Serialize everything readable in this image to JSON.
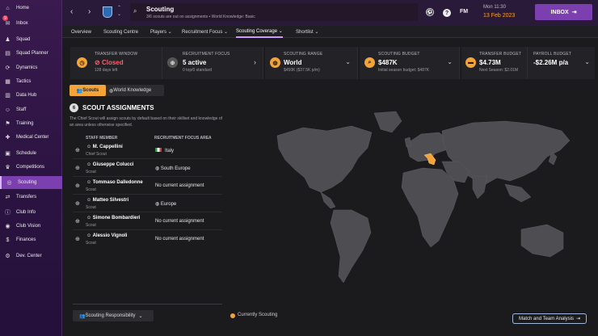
{
  "sidebar": {
    "items": [
      {
        "label": "Home",
        "icon": "home-icon"
      },
      {
        "label": "Inbox",
        "icon": "inbox-icon",
        "badge": "9"
      },
      {
        "label": "Squad",
        "icon": "squad-icon"
      },
      {
        "label": "Squad Planner",
        "icon": "planner-icon"
      },
      {
        "label": "Dynamics",
        "icon": "dynamics-icon"
      },
      {
        "label": "Tactics",
        "icon": "tactics-icon"
      },
      {
        "label": "Data Hub",
        "icon": "data-hub-icon"
      },
      {
        "label": "Staff",
        "icon": "staff-icon"
      },
      {
        "label": "Training",
        "icon": "training-icon"
      },
      {
        "label": "Medical Center",
        "icon": "medical-icon"
      },
      {
        "label": "Schedule",
        "icon": "schedule-icon"
      },
      {
        "label": "Competitions",
        "icon": "trophy-icon"
      },
      {
        "label": "Scouting",
        "icon": "scouting-icon",
        "active": true
      },
      {
        "label": "Transfers",
        "icon": "transfers-icon"
      },
      {
        "label": "Club Info",
        "icon": "info-icon"
      },
      {
        "label": "Club Vision",
        "icon": "vision-icon"
      },
      {
        "label": "Finances",
        "icon": "finances-icon"
      },
      {
        "label": "Dev. Center",
        "icon": "dev-center-icon"
      }
    ]
  },
  "header": {
    "title": "Scouting",
    "subtitle": "3/6 scouts are out on assignments • World Knowledge: Basic",
    "day": "Mon 11:30",
    "date": "13 Feb 2023",
    "inbox_label": "INBOX",
    "fm_logo": "FM",
    "help": "?"
  },
  "tabs": [
    {
      "label": "Overview"
    },
    {
      "label": "Scouting Centre"
    },
    {
      "label": "Players ⌄"
    },
    {
      "label": "Recruitment Focus ⌄"
    },
    {
      "label": "Scouting Coverage ⌄",
      "active": true
    },
    {
      "label": "Shortlist ⌄"
    }
  ],
  "cards": {
    "transfer_window": {
      "label": "TRANSFER WINDOW",
      "value": "Closed",
      "sub": "128 days left"
    },
    "recruitment_focus": {
      "label": "RECRUITMENT FOCUS",
      "value": "5 active",
      "sub": "0 top/0 standard"
    },
    "scouting_range": {
      "label": "SCOUTING RANGE",
      "value": "World",
      "sub": "$450K ($37.5K p/m)"
    },
    "scouting_budget": {
      "label": "SCOUTING BUDGET",
      "value": "$487K",
      "sub": "Initial season budget: $487K"
    },
    "transfer_budget": {
      "label": "TRANSFER BUDGET",
      "value": "$4.73M",
      "sub": "Next Season: $2.01M"
    },
    "payroll_budget": {
      "label": "PAYROLL BUDGET",
      "value": "-$2.26M p/a"
    }
  },
  "toggle": {
    "scouts": "Scouts",
    "world": "World Knowledge"
  },
  "assignments": {
    "count": "6",
    "title": "SCOUT ASSIGNMENTS",
    "desc": "The Chief Scout will assign scouts by default based on their skillset and knowledge of an area unless otherwise specified.",
    "col_staff": "STAFF MEMBER",
    "col_focus": "RECRUITMENT FOCUS AREA",
    "rows": [
      {
        "name": "M. Cappellini",
        "role": "Chief Scout",
        "focus": "Italy"
      },
      {
        "name": "Giuseppe Colucci",
        "role": "Scout",
        "focus": "South Europe"
      },
      {
        "name": "Tommaso Dalledonne",
        "role": "Scout",
        "focus": "No current assignment"
      },
      {
        "name": "Matteo Silvestri",
        "role": "Scout",
        "focus": "Europe"
      },
      {
        "name": "Simone Bombardieri",
        "role": "Scout",
        "focus": "No current assignment"
      },
      {
        "name": "Alessio Vignoli",
        "role": "Scout",
        "focus": "No current assignment"
      }
    ]
  },
  "footer": {
    "responsibility": "Scouting Responsibility",
    "legend": "Currently Scouting",
    "analysis": "Match and Team Analysis"
  },
  "colors": {
    "accent": "#7c3fb0",
    "highlight": "#f2a33a"
  }
}
